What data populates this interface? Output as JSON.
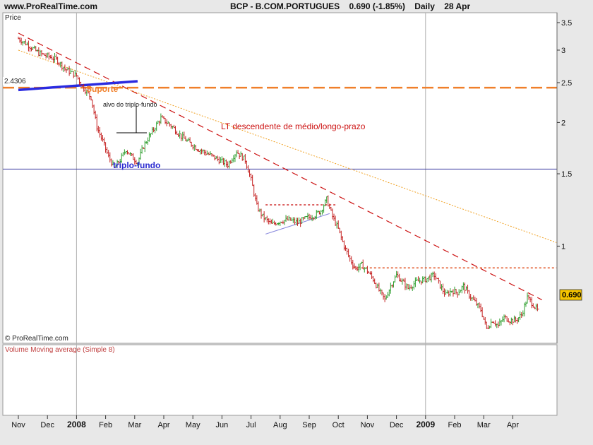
{
  "header": {
    "site": "www.ProRealTime.com",
    "instrument": "BCP - B.COM.PORTUGUES",
    "quote": "0.690 (-1.85%)",
    "period": "Daily",
    "date": "28 Apr"
  },
  "chart_data": [
    {
      "type": "line",
      "panel_label": "Price",
      "scale": "log",
      "ylim": [
        0.58,
        3.7
      ],
      "yticks": [
        {
          "value": 3.5,
          "label": "3.5"
        },
        {
          "value": 3,
          "label": "3"
        },
        {
          "value": 2.5,
          "label": "2.5"
        },
        {
          "value": 2,
          "label": "2"
        },
        {
          "value": 1.5,
          "label": "1.5"
        },
        {
          "value": 1,
          "label": "1"
        }
      ],
      "x_labels": [
        {
          "label": "Nov",
          "bold": false
        },
        {
          "label": "Dec",
          "bold": false
        },
        {
          "label": "2008",
          "bold": true
        },
        {
          "label": "Feb",
          "bold": false
        },
        {
          "label": "Mar",
          "bold": false
        },
        {
          "label": "Apr",
          "bold": false
        },
        {
          "label": "May",
          "bold": false
        },
        {
          "label": "Jun",
          "bold": false
        },
        {
          "label": "Jul",
          "bold": false
        },
        {
          "label": "Aug",
          "bold": false
        },
        {
          "label": "Sep",
          "bold": false
        },
        {
          "label": "Oct",
          "bold": false
        },
        {
          "label": "Nov",
          "bold": false
        },
        {
          "label": "Dec",
          "bold": false
        },
        {
          "label": "2009",
          "bold": true
        },
        {
          "label": "Feb",
          "bold": false
        },
        {
          "label": "Mar",
          "bold": false
        },
        {
          "label": "Apr",
          "bold": false
        }
      ],
      "price_path": [
        [
          0,
          3.2
        ],
        [
          0.3,
          3.1
        ],
        [
          0.7,
          2.95
        ],
        [
          1.0,
          2.9
        ],
        [
          1.3,
          2.85
        ],
        [
          1.6,
          2.7
        ],
        [
          2.0,
          2.6
        ],
        [
          2.2,
          2.45
        ],
        [
          2.5,
          2.3
        ],
        [
          2.7,
          1.95
        ],
        [
          2.9,
          1.8
        ],
        [
          3.1,
          1.65
        ],
        [
          3.3,
          1.55
        ],
        [
          3.5,
          1.62
        ],
        [
          3.7,
          1.72
        ],
        [
          3.9,
          1.65
        ],
        [
          4.1,
          1.6
        ],
        [
          4.3,
          1.75
        ],
        [
          4.5,
          1.85
        ],
        [
          4.7,
          1.95
        ],
        [
          4.9,
          2.05
        ],
        [
          5.1,
          2.0
        ],
        [
          5.3,
          1.95
        ],
        [
          5.6,
          1.85
        ],
        [
          5.9,
          1.78
        ],
        [
          6.2,
          1.72
        ],
        [
          6.5,
          1.68
        ],
        [
          6.9,
          1.62
        ],
        [
          7.2,
          1.58
        ],
        [
          7.5,
          1.7
        ],
        [
          7.8,
          1.62
        ],
        [
          8.0,
          1.45
        ],
        [
          8.2,
          1.25
        ],
        [
          8.4,
          1.18
        ],
        [
          8.7,
          1.13
        ],
        [
          9.0,
          1.15
        ],
        [
          9.3,
          1.16
        ],
        [
          9.6,
          1.14
        ],
        [
          9.9,
          1.17
        ],
        [
          10.2,
          1.19
        ],
        [
          10.4,
          1.22
        ],
        [
          10.6,
          1.3
        ],
        [
          10.8,
          1.18
        ],
        [
          11.0,
          1.1
        ],
        [
          11.2,
          1.0
        ],
        [
          11.4,
          0.93
        ],
        [
          11.6,
          0.88
        ],
        [
          11.8,
          0.9
        ],
        [
          12.0,
          0.87
        ],
        [
          12.2,
          0.83
        ],
        [
          12.4,
          0.78
        ],
        [
          12.6,
          0.74
        ],
        [
          12.8,
          0.8
        ],
        [
          13.0,
          0.85
        ],
        [
          13.2,
          0.82
        ],
        [
          13.4,
          0.79
        ],
        [
          13.7,
          0.82
        ],
        [
          14.0,
          0.83
        ],
        [
          14.3,
          0.85
        ],
        [
          14.5,
          0.8
        ],
        [
          14.7,
          0.76
        ],
        [
          14.9,
          0.78
        ],
        [
          15.1,
          0.77
        ],
        [
          15.3,
          0.8
        ],
        [
          15.5,
          0.76
        ],
        [
          15.7,
          0.73
        ],
        [
          15.9,
          0.7
        ],
        [
          16.1,
          0.63
        ],
        [
          16.3,
          0.66
        ],
        [
          16.5,
          0.64
        ],
        [
          16.7,
          0.67
        ],
        [
          16.9,
          0.66
        ],
        [
          17.1,
          0.66
        ],
        [
          17.3,
          0.68
        ],
        [
          17.5,
          0.75
        ],
        [
          17.7,
          0.72
        ],
        [
          17.9,
          0.69
        ]
      ],
      "current_price": {
        "value": 0.69,
        "label": "0.690"
      },
      "price_marker_label": "2.4306",
      "levels": [
        {
          "name": "suporte",
          "value": 2.43,
          "color": "#f07f2a"
        },
        {
          "name": "triplo-fundo",
          "value": 1.54,
          "color": "#3a3aa0"
        }
      ],
      "trendlines": [
        {
          "name": "lt-descendente",
          "from": [
            0,
            3.3
          ],
          "to": [
            18.0,
            0.74
          ],
          "color": "#cc1111"
        },
        {
          "name": "orange-dotted",
          "from": [
            0,
            3.0
          ],
          "to": [
            18.5,
            1.02
          ],
          "color": "#f0a020"
        },
        {
          "name": "blue-trendline",
          "from": [
            0,
            2.4
          ],
          "to": [
            4.1,
            2.52
          ],
          "color": "#2a2ae0"
        },
        {
          "name": "range-top",
          "from": [
            8.5,
            1.26
          ],
          "to": [
            10.9,
            1.26
          ],
          "color": "#d03030"
        },
        {
          "name": "resistance-top",
          "from": [
            11.5,
            0.885
          ],
          "to": [
            18.5,
            0.885
          ],
          "color": "#e05020"
        },
        {
          "name": "rising-support",
          "from": [
            8.5,
            1.07
          ],
          "to": [
            10.7,
            1.2
          ],
          "color": "#8888dd"
        }
      ],
      "annotations": [
        {
          "text": "Suporte",
          "color": "#f07f2a"
        },
        {
          "text": "alvo do triplo-fundo",
          "color": "#111111"
        },
        {
          "text": "LT descendente de médio/longo-prazo",
          "color": "#cc1111"
        },
        {
          "text": "triplo-fundo",
          "color": "#2a2ad0"
        }
      ],
      "watermark": "© ProRealTime.com"
    },
    {
      "type": "line",
      "panel_label": "Volume Moving average (Simple 8)",
      "series": []
    }
  ]
}
